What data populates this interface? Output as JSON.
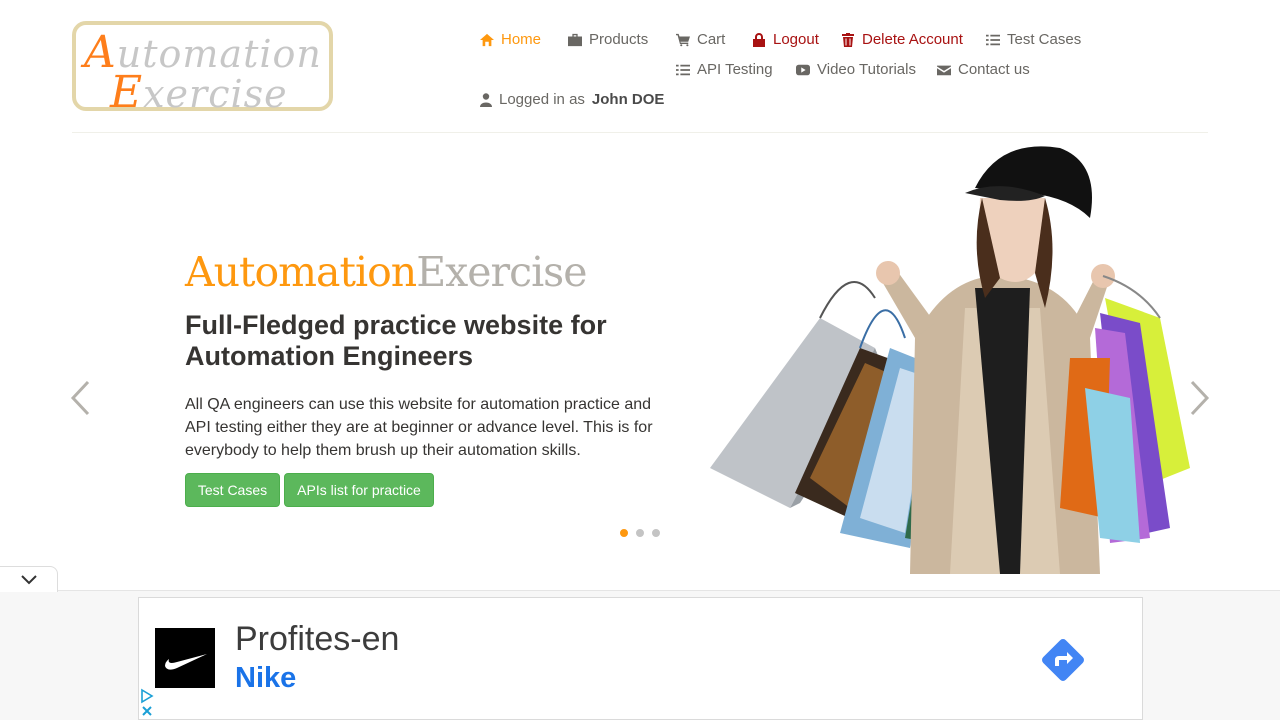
{
  "logo": {
    "line1_cap": "A",
    "line1_rest": "utomation",
    "line2_cap": "E",
    "line2_rest": "xercise"
  },
  "nav": {
    "home": "Home",
    "products": "Products",
    "cart": "Cart",
    "logout": "Logout",
    "delete_account": "Delete Account",
    "test_cases": "Test Cases",
    "api_testing": "API Testing",
    "video_tutorials": "Video Tutorials",
    "contact_us": "Contact us",
    "logged_in_prefix": "Logged in as",
    "logged_in_user": "John DOE"
  },
  "slider": {
    "brand_a": "Automation",
    "brand_e": "Exercise",
    "headline": "Full-Fledged practice website for Automation Engineers",
    "description": "All QA engineers can use this website for automation practice and API testing either they are at beginner or advance level. This is for everybody to help them brush up their automation skills.",
    "btn_test_cases": "Test Cases",
    "btn_apis": "APIs list for practice",
    "active_slide": 1,
    "slide_count": 3
  },
  "ad": {
    "title": "Profites-en",
    "subtitle": "Nike"
  },
  "colors": {
    "accent": "#fe980f",
    "danger": "#a81212",
    "button_green": "#5cb85c",
    "ad_blue": "#1a73e8"
  }
}
